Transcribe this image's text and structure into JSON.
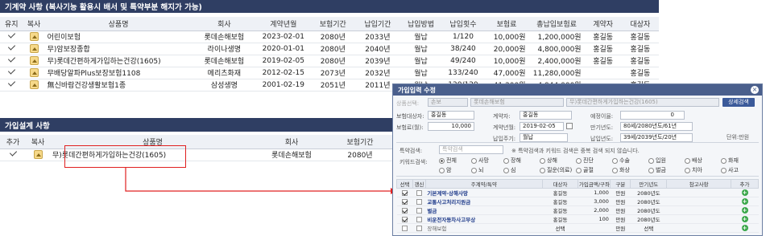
{
  "top_panel": {
    "title": "기계약 사항 (복사기능 활용시 배서 및 특약부분 해지가 가능)",
    "headers": [
      "유지",
      "복사",
      "상품명",
      "회사",
      "계약년월",
      "보험기간",
      "납입기간",
      "납입방법",
      "납입횟수",
      "보험료",
      "총납입보험료",
      "계약자",
      "대상자"
    ],
    "rows": [
      {
        "name": "어린이보험",
        "company": "롯데손해보험",
        "date": "2023-02-01",
        "term": "2080년",
        "pay_term": "2033년",
        "method": "월납",
        "count": "1/120",
        "premium": "10,000원",
        "total": "1,200,000원",
        "contractor": "홍길동",
        "insured": "홍길동"
      },
      {
        "name": "무)암보장종합",
        "company": "라이나생명",
        "date": "2020-01-01",
        "term": "2080년",
        "pay_term": "2040년",
        "method": "월납",
        "count": "38/240",
        "premium": "20,000원",
        "total": "4,800,000원",
        "contractor": "홍길동",
        "insured": "홍길동"
      },
      {
        "name": "무)롯데간편하게가입하는건강(1605)",
        "company": "롯데손해보험",
        "date": "2019-02-05",
        "term": "2080년",
        "pay_term": "2039년",
        "method": "월납",
        "count": "49/240",
        "premium": "10,000원",
        "total": "2,400,000원",
        "contractor": "홍길동",
        "insured": "홍길동"
      },
      {
        "name": "무배당알파Plus보장보험1108",
        "company": "메리츠화재",
        "date": "2012-02-15",
        "term": "2073년",
        "pay_term": "2032년",
        "method": "월납",
        "count": "133/240",
        "premium": "47,000원",
        "total": "11,280,000원",
        "contractor": "",
        "insured": "홍길동"
      },
      {
        "name": "無신바람건강생활보험1종",
        "company": "삼성생명",
        "date": "2001-02-19",
        "term": "2051년",
        "pay_term": "2011년",
        "method": "월납",
        "count": "120/120",
        "premium": "41,200원",
        "total": "4,944,000원",
        "contractor": "",
        "insured": "홍길동"
      }
    ]
  },
  "bottom_panel": {
    "title": "가입설계 사항",
    "headers": [
      "추가",
      "복사",
      "상품명",
      "회사",
      "보험기간"
    ],
    "row": {
      "name": "무)롯데간편하게가입하는건강(1605)",
      "company": "롯데손해보험",
      "term": "2080년"
    }
  },
  "dialog": {
    "title": "가입입력 수정",
    "close": "×",
    "product_label": "상품선택:",
    "insurer_type": "손보",
    "insurer": "롯데손해보험",
    "product": "무)롯데간편하게가입하는건강(1605)",
    "detail_btn": "상세검색",
    "insured_label": "보험대상자:",
    "insured": "홍길동",
    "contractor_label": "계약자:",
    "contractor": "홍길동",
    "expect_age_label": "예정이율:",
    "expect_age": "0",
    "premium_label": "보험료(월):",
    "premium": "10,000",
    "contract_date_label": "계약년월:",
    "contract_date": "2019-02-05",
    "maturity_label": "만기년도:",
    "maturity": "80세/2080년도/61년",
    "pay_cycle_label": "납입주기:",
    "pay_cycle": "월납",
    "pay_term_label": "납입년도:",
    "pay_term": "39세/2039년도/20년",
    "unit": "단위:만원",
    "rider_search_label": "특약검색:",
    "rider_search_placeholder": "특약검색",
    "rider_note": "※ 특약검색과 키워드 검색은 중복 검색 되지 않습니다.",
    "keyword_label": "키워드검색:",
    "keywords_row1": [
      "전체",
      "사망",
      "장해",
      "상해",
      "진단",
      "수술",
      "입원",
      "배상",
      "화재"
    ],
    "keywords_row2": [
      "암",
      "뇌",
      "심",
      "질운(의료)",
      "골절",
      "화상",
      "벌금",
      "치아",
      "사고"
    ],
    "table_headers": [
      "선택",
      "갱신",
      "주계약/특약",
      "대상자",
      "가입금액/구좌",
      "구분",
      "만기년도",
      "참고사항",
      "추가"
    ],
    "table_rows": [
      {
        "checked": true,
        "renew": false,
        "name": "기본계약-상해사망",
        "target": "홍길동",
        "amount": "1,000",
        "unit": "만원",
        "year": "2080년도",
        "note": ""
      },
      {
        "checked": true,
        "renew": false,
        "name": "교통사고처리지원금",
        "target": "홍길동",
        "amount": "3,000",
        "unit": "만원",
        "year": "2080년도",
        "note": ""
      },
      {
        "checked": true,
        "renew": false,
        "name": "벌금",
        "target": "홍길동",
        "amount": "2,000",
        "unit": "만원",
        "year": "2080년도",
        "note": ""
      },
      {
        "checked": true,
        "renew": false,
        "name": "비운전자동차사고부상",
        "target": "홍길동",
        "amount": "100",
        "unit": "만원",
        "year": "2080년도",
        "note": ""
      },
      {
        "checked": false,
        "renew": false,
        "name": "장해보험",
        "target": "선택",
        "amount": "",
        "unit": "만원",
        "year": "선택",
        "note": ""
      }
    ]
  }
}
